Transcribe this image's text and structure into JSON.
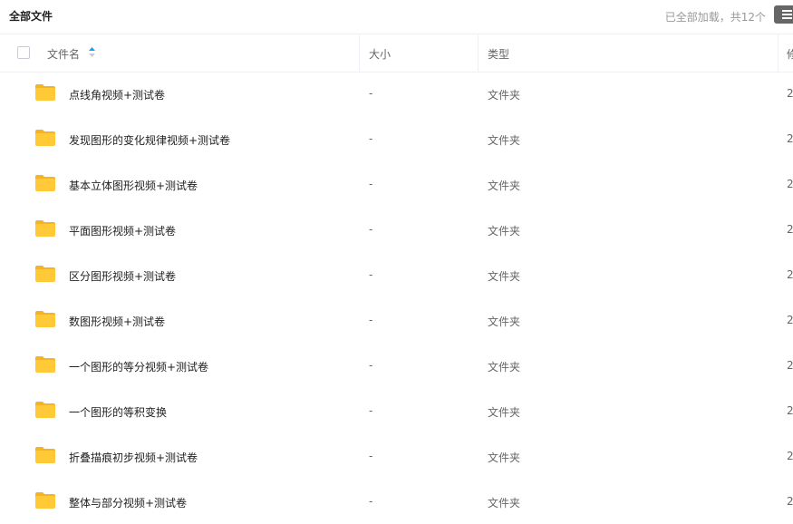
{
  "header": {
    "title": "全部文件",
    "status": "已全部加载，共12个"
  },
  "columns": {
    "name": "文件名",
    "size": "大小",
    "type": "类型",
    "modified": "修"
  },
  "files": [
    {
      "name": "点线角视频+测试卷",
      "size": "-",
      "type": "文件夹",
      "date": "2"
    },
    {
      "name": "发现图形的变化规律视频+测试卷",
      "size": "-",
      "type": "文件夹",
      "date": "2"
    },
    {
      "name": "基本立体图形视频+测试卷",
      "size": "-",
      "type": "文件夹",
      "date": "2"
    },
    {
      "name": "平面图形视频+测试卷",
      "size": "-",
      "type": "文件夹",
      "date": "2"
    },
    {
      "name": "区分图形视频+测试卷",
      "size": "-",
      "type": "文件夹",
      "date": "2"
    },
    {
      "name": "数图形视频+测试卷",
      "size": "-",
      "type": "文件夹",
      "date": "2"
    },
    {
      "name": "一个图形的等分视频+测试卷",
      "size": "-",
      "type": "文件夹",
      "date": "2"
    },
    {
      "name": "一个图形的等积变换",
      "size": "-",
      "type": "文件夹",
      "date": "2"
    },
    {
      "name": "折叠描痕初步视频+测试卷",
      "size": "-",
      "type": "文件夹",
      "date": "2"
    },
    {
      "name": "整体与部分视频+测试卷",
      "size": "-",
      "type": "文件夹",
      "date": "2"
    }
  ],
  "icons": {
    "folder": "folder-icon",
    "menu": "menu-icon",
    "sort": "sort-icon"
  },
  "colors": {
    "folder": "#FFC937",
    "sort_accent": "#06A7FF"
  }
}
